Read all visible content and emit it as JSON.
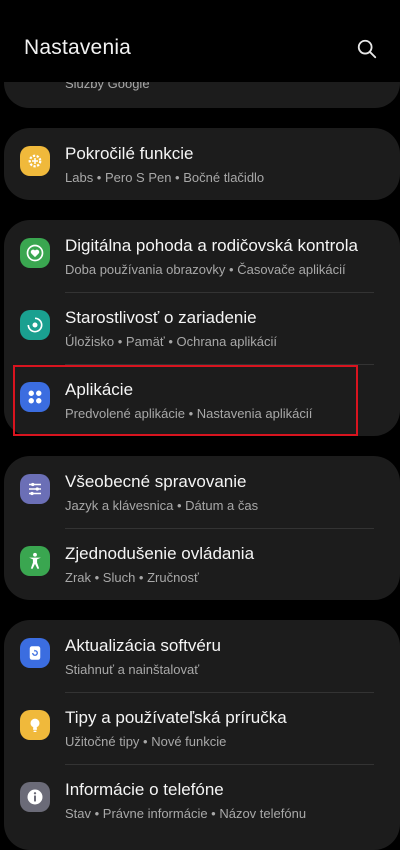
{
  "header": {
    "title": "Nastavenia",
    "search_icon": "search-icon"
  },
  "top_partial": {
    "subtitle": "Služby Google",
    "icon_color": "#3b6de0"
  },
  "rows": [
    {
      "title": "Pokročilé funkcie",
      "subtitle": "Labs • Pero S Pen • Bočné tlačidlo",
      "icon": "gear-plus-icon",
      "color": "#f0b93b"
    },
    {
      "title": "Digitálna pohoda a rodičovská kontrola",
      "subtitle": "Doba používania obrazovky • Časovače aplikácií",
      "icon": "heart-circle-icon",
      "color": "#3aa650"
    },
    {
      "title": "Starostlivosť o zariadenie",
      "subtitle": "Úložisko • Pamäť • Ochrana aplikácií",
      "icon": "device-care-icon",
      "color": "#1aa090"
    },
    {
      "title": "Aplikácie",
      "subtitle": "Predvolené aplikácie • Nastavenia aplikácií",
      "icon": "apps-grid-icon",
      "color": "#3b6de0"
    },
    {
      "title": "Všeobecné spravovanie",
      "subtitle": "Jazyk a klávesnica • Dátum a čas",
      "icon": "sliders-icon",
      "color": "#6b6fb6"
    },
    {
      "title": "Zjednodušenie ovládania",
      "subtitle": "Zrak • Sluch • Zručnosť",
      "icon": "accessibility-icon",
      "color": "#3aa650"
    },
    {
      "title": "Aktualizácia softvéru",
      "subtitle": "Stiahnuť a nainštalovať",
      "icon": "software-update-icon",
      "color": "#3b6de0"
    },
    {
      "title": "Tipy a používateľská príručka",
      "subtitle": "Užitočné tipy • Nové funkcie",
      "icon": "lightbulb-icon",
      "color": "#f0b93b"
    },
    {
      "title": "Informácie o telefóne",
      "subtitle": "Stav • Právne informácie • Názov telefónu",
      "icon": "info-icon",
      "color": "#6b6b78"
    }
  ]
}
